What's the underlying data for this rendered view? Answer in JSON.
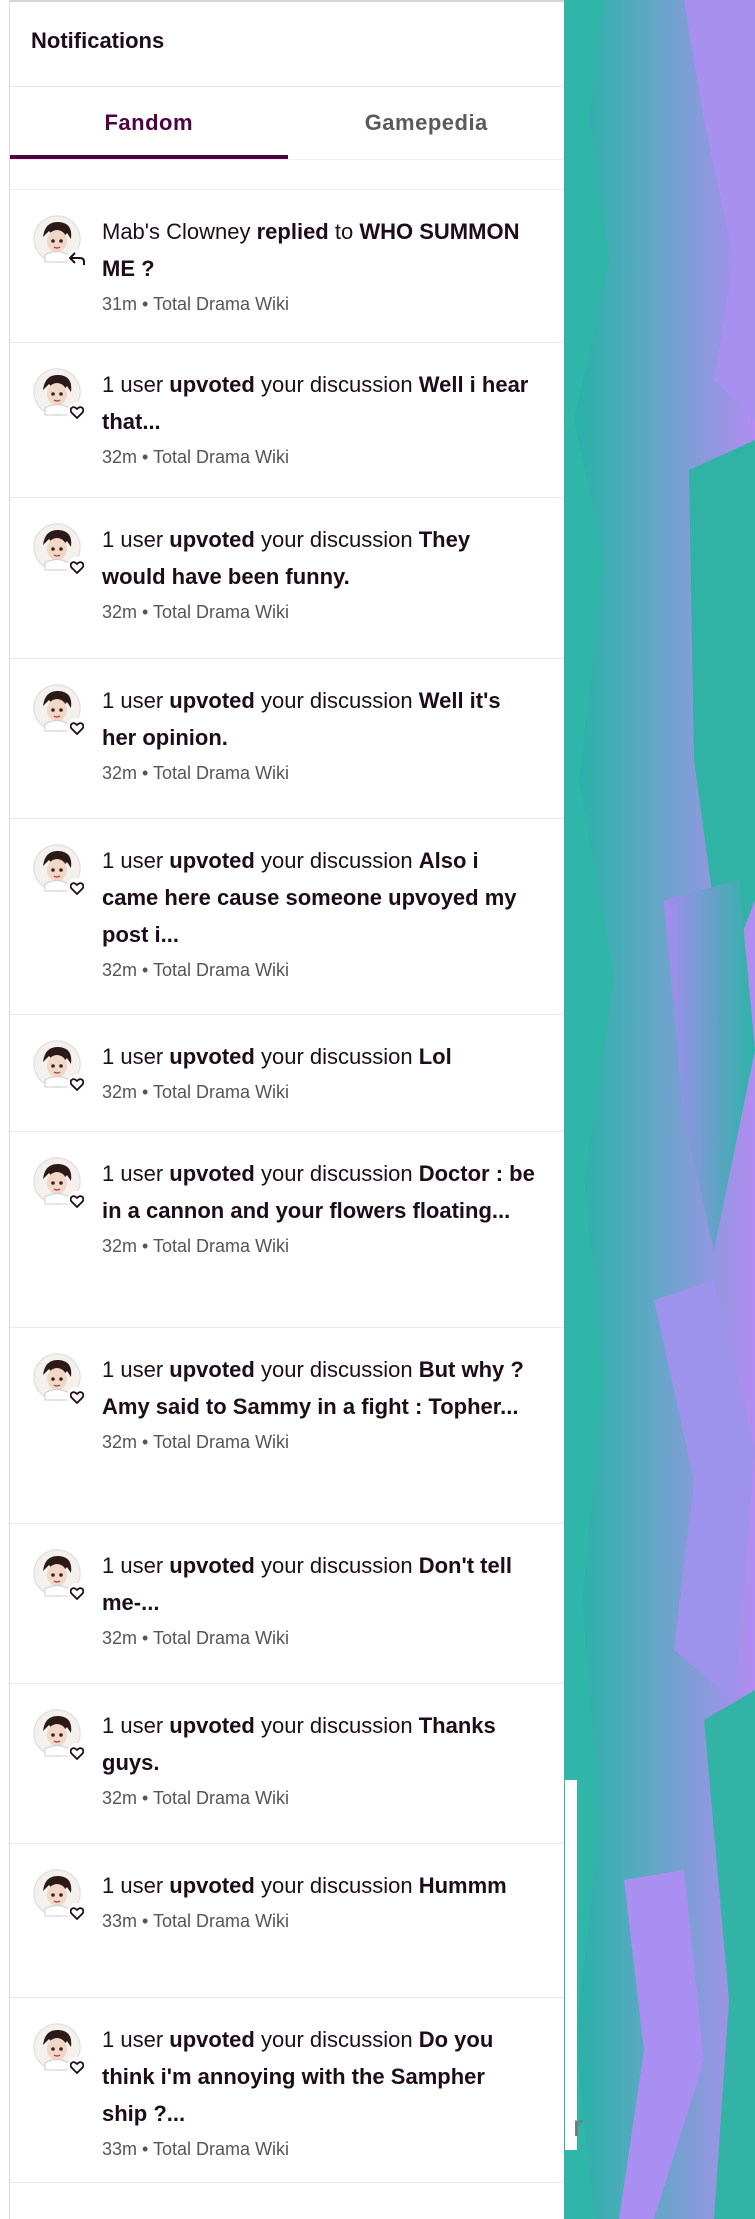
{
  "header": {
    "title": "Notifications"
  },
  "tabs": [
    {
      "label": "Fandom",
      "active": true
    },
    {
      "label": "Gamepedia",
      "active": false
    }
  ],
  "notifications": [
    {
      "type": "reply",
      "actor": "Mab's Clowney",
      "action": "replied",
      "connector": "to",
      "post": "WHO SUMMON ME ?",
      "time": "31m",
      "wiki": "Total Drama Wiki"
    },
    {
      "type": "upvote",
      "actor": "1 user",
      "action": "upvoted",
      "connector": "your discussion",
      "post": "Well i hear that...",
      "time": "32m",
      "wiki": "Total Drama Wiki"
    },
    {
      "type": "upvote",
      "actor": "1 user",
      "action": "upvoted",
      "connector": "your discussion",
      "post": "They would have been funny.",
      "time": "32m",
      "wiki": "Total Drama Wiki"
    },
    {
      "type": "upvote",
      "actor": "1 user",
      "action": "upvoted",
      "connector": "your discussion",
      "post": "Well it's her opinion.",
      "time": "32m",
      "wiki": "Total Drama Wiki"
    },
    {
      "type": "upvote",
      "actor": "1 user",
      "action": "upvoted",
      "connector": "your discussion",
      "post": "Also i came here cause someone upvoyed my post i...",
      "time": "32m",
      "wiki": "Total Drama Wiki"
    },
    {
      "type": "upvote",
      "actor": "1 user",
      "action": "upvoted",
      "connector": "your discussion",
      "post": "Lol",
      "time": "32m",
      "wiki": "Total Drama Wiki"
    },
    {
      "type": "upvote",
      "actor": "1 user",
      "action": "upvoted",
      "connector": "your discussion",
      "post": "Doctor : be in a cannon and your flowers floating...",
      "time": "32m",
      "wiki": "Total Drama Wiki"
    },
    {
      "type": "upvote",
      "actor": "1 user",
      "action": "upvoted",
      "connector": "your discussion",
      "post": "But why ? Amy said to Sammy in a fight : Topher...",
      "time": "32m",
      "wiki": "Total Drama Wiki"
    },
    {
      "type": "upvote",
      "actor": "1 user",
      "action": "upvoted",
      "connector": "your discussion",
      "post": "Don't tell me-...",
      "time": "32m",
      "wiki": "Total Drama Wiki"
    },
    {
      "type": "upvote",
      "actor": "1 user",
      "action": "upvoted",
      "connector": "your discussion",
      "post": "Thanks guys.",
      "time": "32m",
      "wiki": "Total Drama Wiki"
    },
    {
      "type": "upvote",
      "actor": "1 user",
      "action": "upvoted",
      "connector": "your discussion",
      "post": "Hummm",
      "time": "33m",
      "wiki": "Total Drama Wiki"
    },
    {
      "type": "upvote",
      "actor": "1 user",
      "action": "upvoted",
      "connector": "your discussion",
      "post": "Do you think i'm annoying with the Sampher ship ?...",
      "time": "33m",
      "wiki": "Total Drama Wiki"
    }
  ],
  "meta_separator": "•",
  "icons": {
    "reply": "reply-arrow-icon",
    "upvote": "heart-icon"
  },
  "colors": {
    "accent": "#520044",
    "teal": "#2fb5a8",
    "lavender": "#a88ef0"
  },
  "stray_glyph": "r"
}
